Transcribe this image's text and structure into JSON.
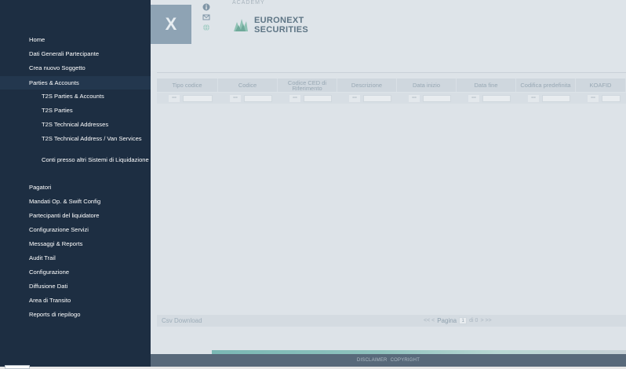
{
  "header": {
    "tile_letter": "X",
    "logo_line1": "EURONEXT",
    "logo_line2": "SECURITIES",
    "top_faded": "ACADEMY",
    "icons": [
      "info-icon",
      "mail-icon",
      "globe-icon"
    ]
  },
  "sidebar": {
    "items": [
      {
        "label": "Home"
      },
      {
        "label": "Dati Generali Partecipante"
      },
      {
        "label": "Crea nuovo Soggetto"
      },
      {
        "label": "Parties & Accounts"
      },
      {
        "label": "T2S Parties & Accounts"
      },
      {
        "label": "T2S Parties"
      },
      {
        "label": "T2S Technical Addresses"
      },
      {
        "label": "T2S Technical Address / Van Services"
      },
      {
        "label": "Conti presso altri Sistemi di Liquidazione"
      },
      {
        "label": "Pagatori"
      },
      {
        "label": "Mandati Op. & Swift Config"
      },
      {
        "label": "Partecipanti del liquidatore"
      },
      {
        "label": "Configurazione Servizi"
      },
      {
        "label": "Messaggi & Reports"
      },
      {
        "label": "Audit Trail"
      },
      {
        "label": "Configurazione"
      },
      {
        "label": "Diffusione Dati"
      },
      {
        "label": "Area di Transito"
      },
      {
        "label": "Reports di riepilogo"
      }
    ]
  },
  "table": {
    "columns": [
      {
        "label": "Tipo codice"
      },
      {
        "label": "Codice"
      },
      {
        "label": "Codice CED di Riferimento"
      },
      {
        "label": "Descrizione"
      },
      {
        "label": "Data inizio"
      },
      {
        "label": "Data fine"
      },
      {
        "label": "Codifica predefinita"
      },
      {
        "label": "KOAFID"
      }
    ],
    "filter_operator": "=="
  },
  "footer": {
    "csv_label": "Csv Download",
    "pager_label": "Pagina",
    "pager_value": "1",
    "pager_of": "di 0",
    "pager_prev": "<< <",
    "pager_next": "> >>"
  },
  "bottom": {
    "disclaimer": "DISCLAIMER",
    "copyright": "COPYRIGHT"
  },
  "colors": {
    "sidebar_bg": "#1d2e42",
    "overlay_bg": "#dde3e8",
    "accent_stripe": "#7ab7b4"
  }
}
